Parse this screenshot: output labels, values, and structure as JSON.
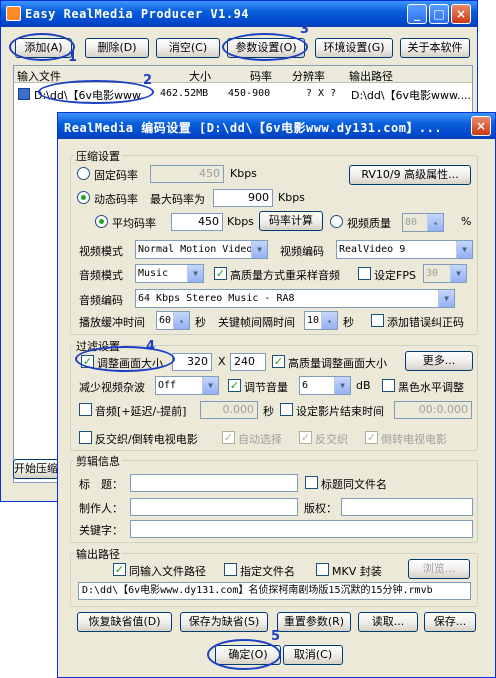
{
  "main": {
    "title": "Easy RealMedia Producer V1.94",
    "buttons": {
      "add": "添加(A)",
      "delete": "删除(D)",
      "clear": "消空(C)",
      "params": "参数设置(O)",
      "env": "环境设置(G)",
      "about": "关于本软件"
    },
    "table": {
      "headers": [
        "输入文件",
        "大小",
        "码率",
        "分辨率",
        "输出路径"
      ],
      "row": {
        "file": "D:\\dd\\【6v电影www.",
        "size": "462.52MB",
        "bitrate": "450-900",
        "resolution": "? X ?",
        "output": "D:\\dd\\【6v电影www...."
      }
    },
    "start_button": "开始压缩"
  },
  "dialog": {
    "title": "RealMedia 编码设置 [D:\\dd\\【6v电影www.dy131.com】...",
    "compress": {
      "group": "压缩设置",
      "fixed_rate_label": "固定码率",
      "fixed_rate_value": "450",
      "kbps": "Kbps",
      "rv_advanced": "RV10/9 高级属性...",
      "dynamic_rate_label": "动态码率",
      "max_rate_label": "最大码率为",
      "max_rate_value": "900",
      "avg_rate_label": "平均码率",
      "avg_rate_value": "450",
      "calc_button": "码率计算",
      "video_quality_label": "视频质量",
      "video_quality_value": "80",
      "percent": "%",
      "video_mode_label": "视频模式",
      "video_mode_value": "Normal Motion Video",
      "video_codec_label": "视频编码",
      "video_codec_value": "RealVideo 9",
      "audio_mode_label": "音频模式",
      "audio_mode_value": "Music",
      "hq_resample_label": "高质量方式重采样音频",
      "set_fps_label": "设定FPS",
      "fps_value": "30",
      "audio_codec_label": "音频编码",
      "audio_codec_value": "64 Kbps Stereo Music - RA8",
      "buffer_label": "播放缓冲时间",
      "buffer_value": "60",
      "sec1": "秒",
      "keyframe_label": "关键帧间隔时间",
      "keyframe_value": "10",
      "sec2": "秒",
      "error_corr_label": "添加错误纠正码"
    },
    "filter": {
      "group": "过滤设置",
      "resize_label": "调整画面大小",
      "width": "320",
      "x": "X",
      "height": "240",
      "hq_resize_label": "高质量调整画面大小",
      "more_button": "更多...",
      "noise_label": "减少视频杂波",
      "noise_value": "Off",
      "volume_label": "调节音量",
      "volume_value": "6",
      "db": "dB",
      "bw_label": "黑色水平调整",
      "audio_delay_label": "音频[+延迟/-提前]",
      "audio_delay_value": "0.000",
      "sec3": "秒",
      "end_time_label": "设定影片结束时间",
      "end_time_value": "00:0.000",
      "deinterlace_label": "反交织/倒转电视电影",
      "auto_label": "自动选择",
      "deint_label": "反交织",
      "inverse_tc_label": "倒转电视电影"
    },
    "clip": {
      "group": "剪辑信息",
      "title_label": "标　题：",
      "same_name_label": "标题同文件名",
      "author_label": "制作人：",
      "copyright_label": "版权：",
      "keywords_label": "关键字："
    },
    "output": {
      "group": "输出路径",
      "same_path_label": "同输入文件路径",
      "specify_name_label": "指定文件名",
      "mkv_label": "MKV 封装",
      "browse_button": "浏览...",
      "path_value": "D:\\dd\\【6v电影www.dy131.com】名侦探柯南剧场版15沉默的15分钟.rmvb"
    },
    "buttons": {
      "restore": "恢复缺省值(D)",
      "save_default": "保存为缺省(S)",
      "reset": "重置参数(R)",
      "read": "读取...",
      "save": "保存...",
      "ok": "确定(O)",
      "cancel": "取消(C)"
    }
  },
  "callouts": [
    "1",
    "2",
    "3",
    "4",
    "5"
  ],
  "colors": {
    "xp_blue": "#0a5fdb",
    "dialog_bg": "#ece9d8",
    "callout": "#1c3fc4",
    "check_green": "#21a121"
  }
}
